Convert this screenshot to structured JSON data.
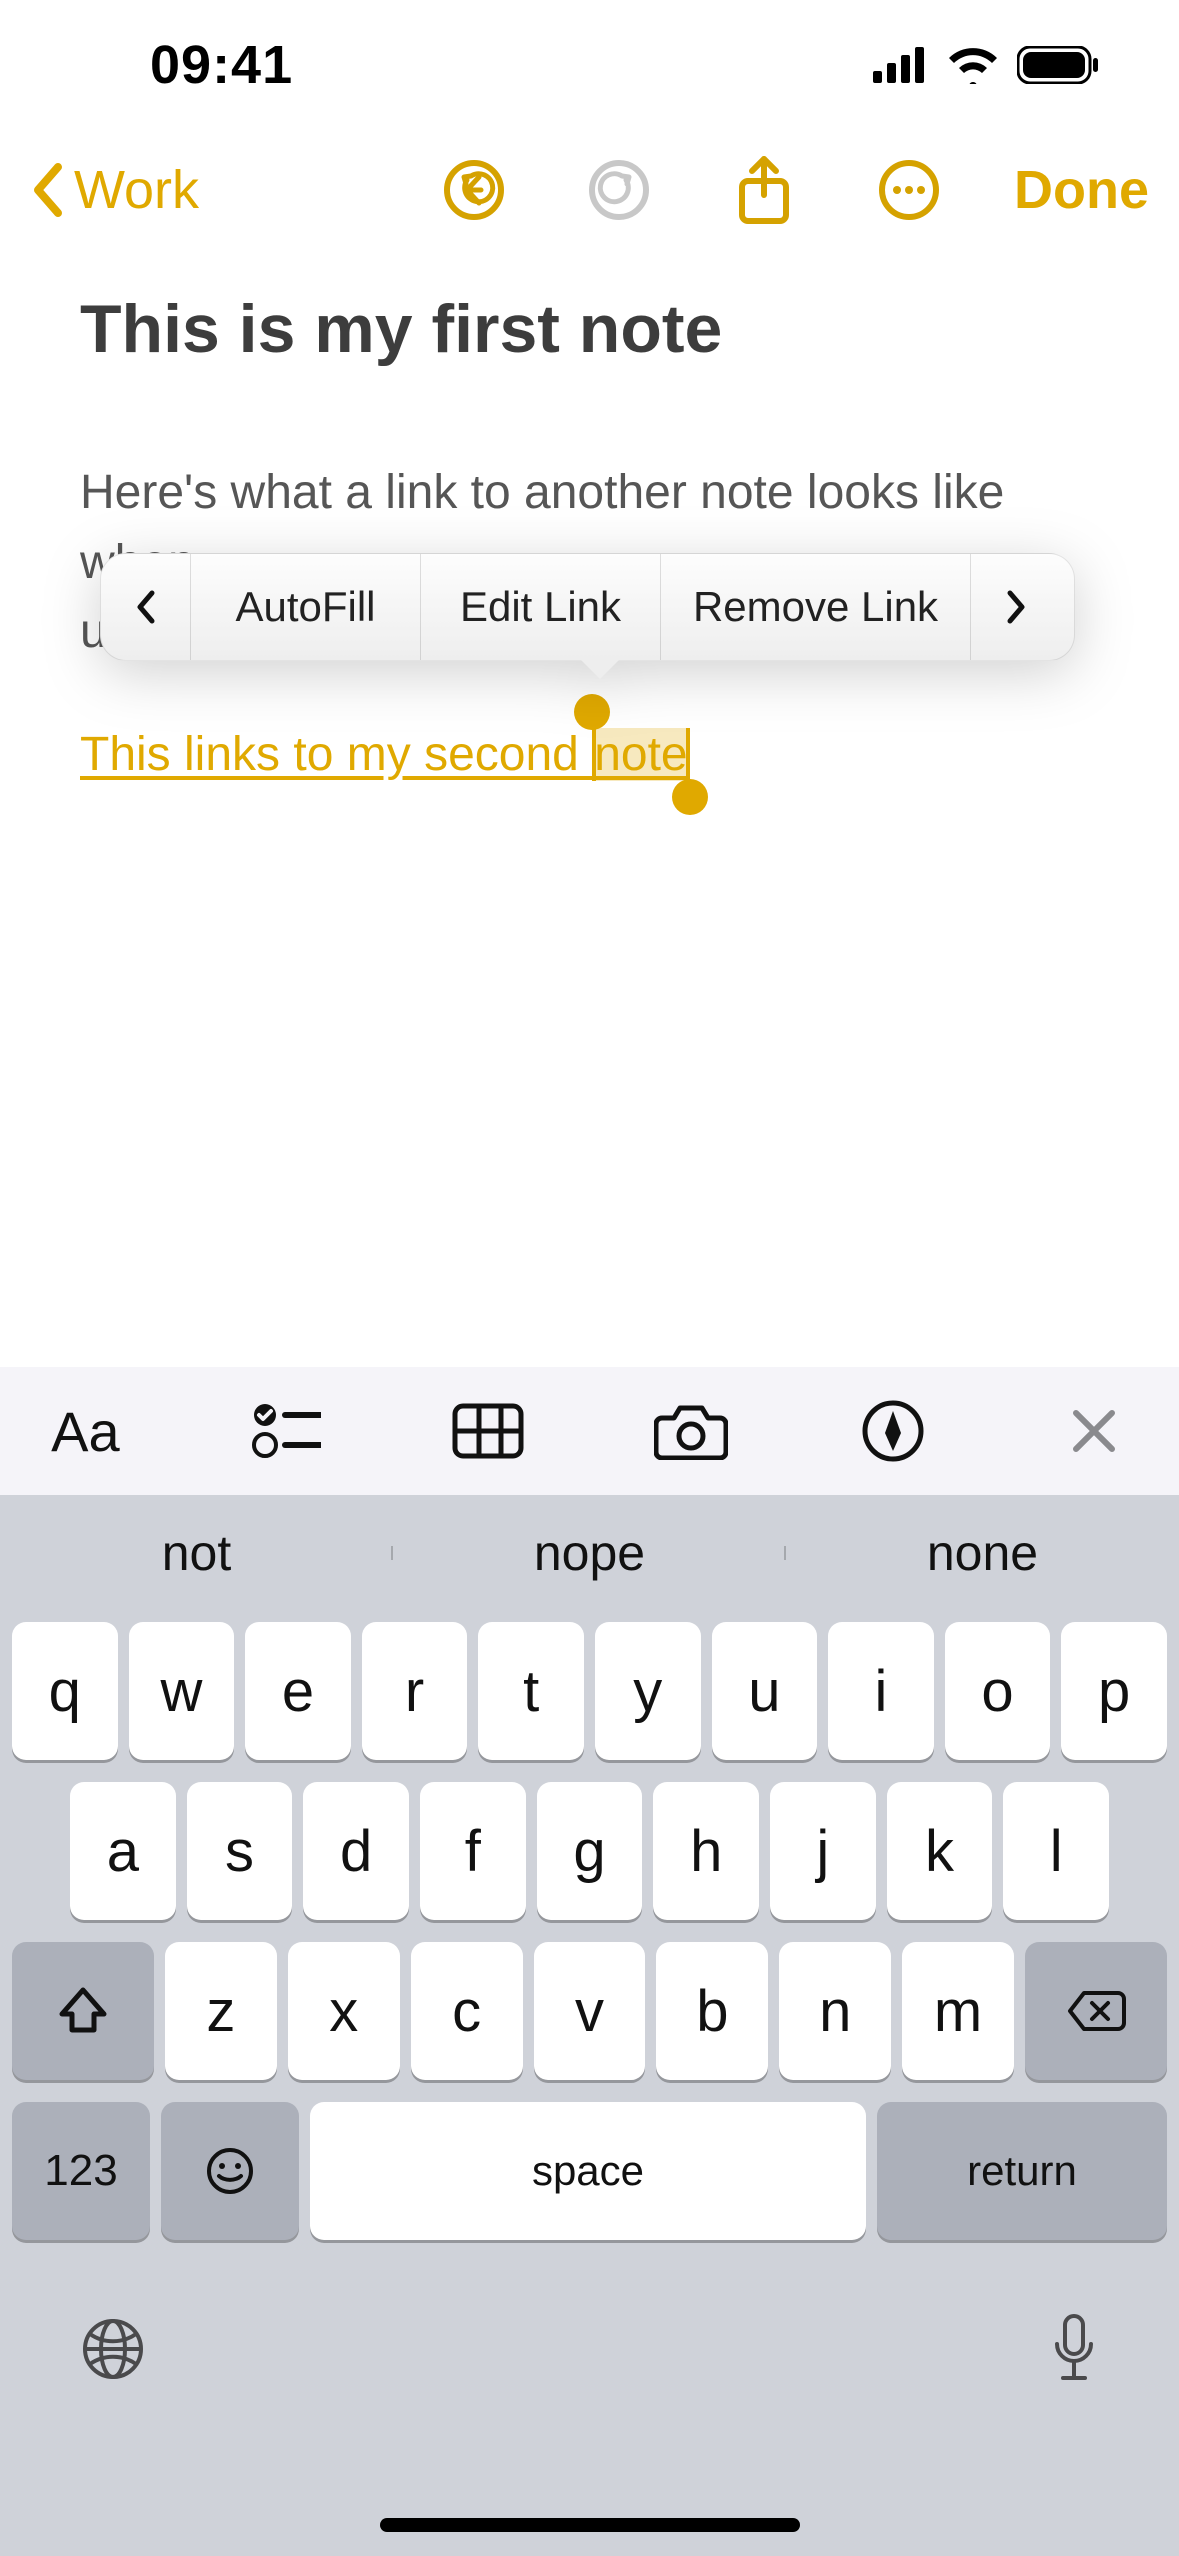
{
  "status": {
    "time": "09:41"
  },
  "nav": {
    "back_label": "Work",
    "done_label": "Done"
  },
  "note": {
    "title": "This is my first note",
    "body_line1": "Here's what a link to another note looks like when",
    "body_line2_prefix": "u",
    "link_text_prefix": "This links to my second ",
    "link_text_selected": "note"
  },
  "popover": {
    "items": [
      "AutoFill",
      "Edit Link",
      "Remove Link"
    ]
  },
  "format_bar": {
    "text_style": "Aa"
  },
  "keyboard": {
    "suggestions": [
      "not",
      "nope",
      "none"
    ],
    "row1": [
      "q",
      "w",
      "e",
      "r",
      "t",
      "y",
      "u",
      "i",
      "o",
      "p"
    ],
    "row2": [
      "a",
      "s",
      "d",
      "f",
      "g",
      "h",
      "j",
      "k",
      "l"
    ],
    "row3": [
      "z",
      "x",
      "c",
      "v",
      "b",
      "n",
      "m"
    ],
    "numkey": "123",
    "space": "space",
    "return": "return"
  }
}
